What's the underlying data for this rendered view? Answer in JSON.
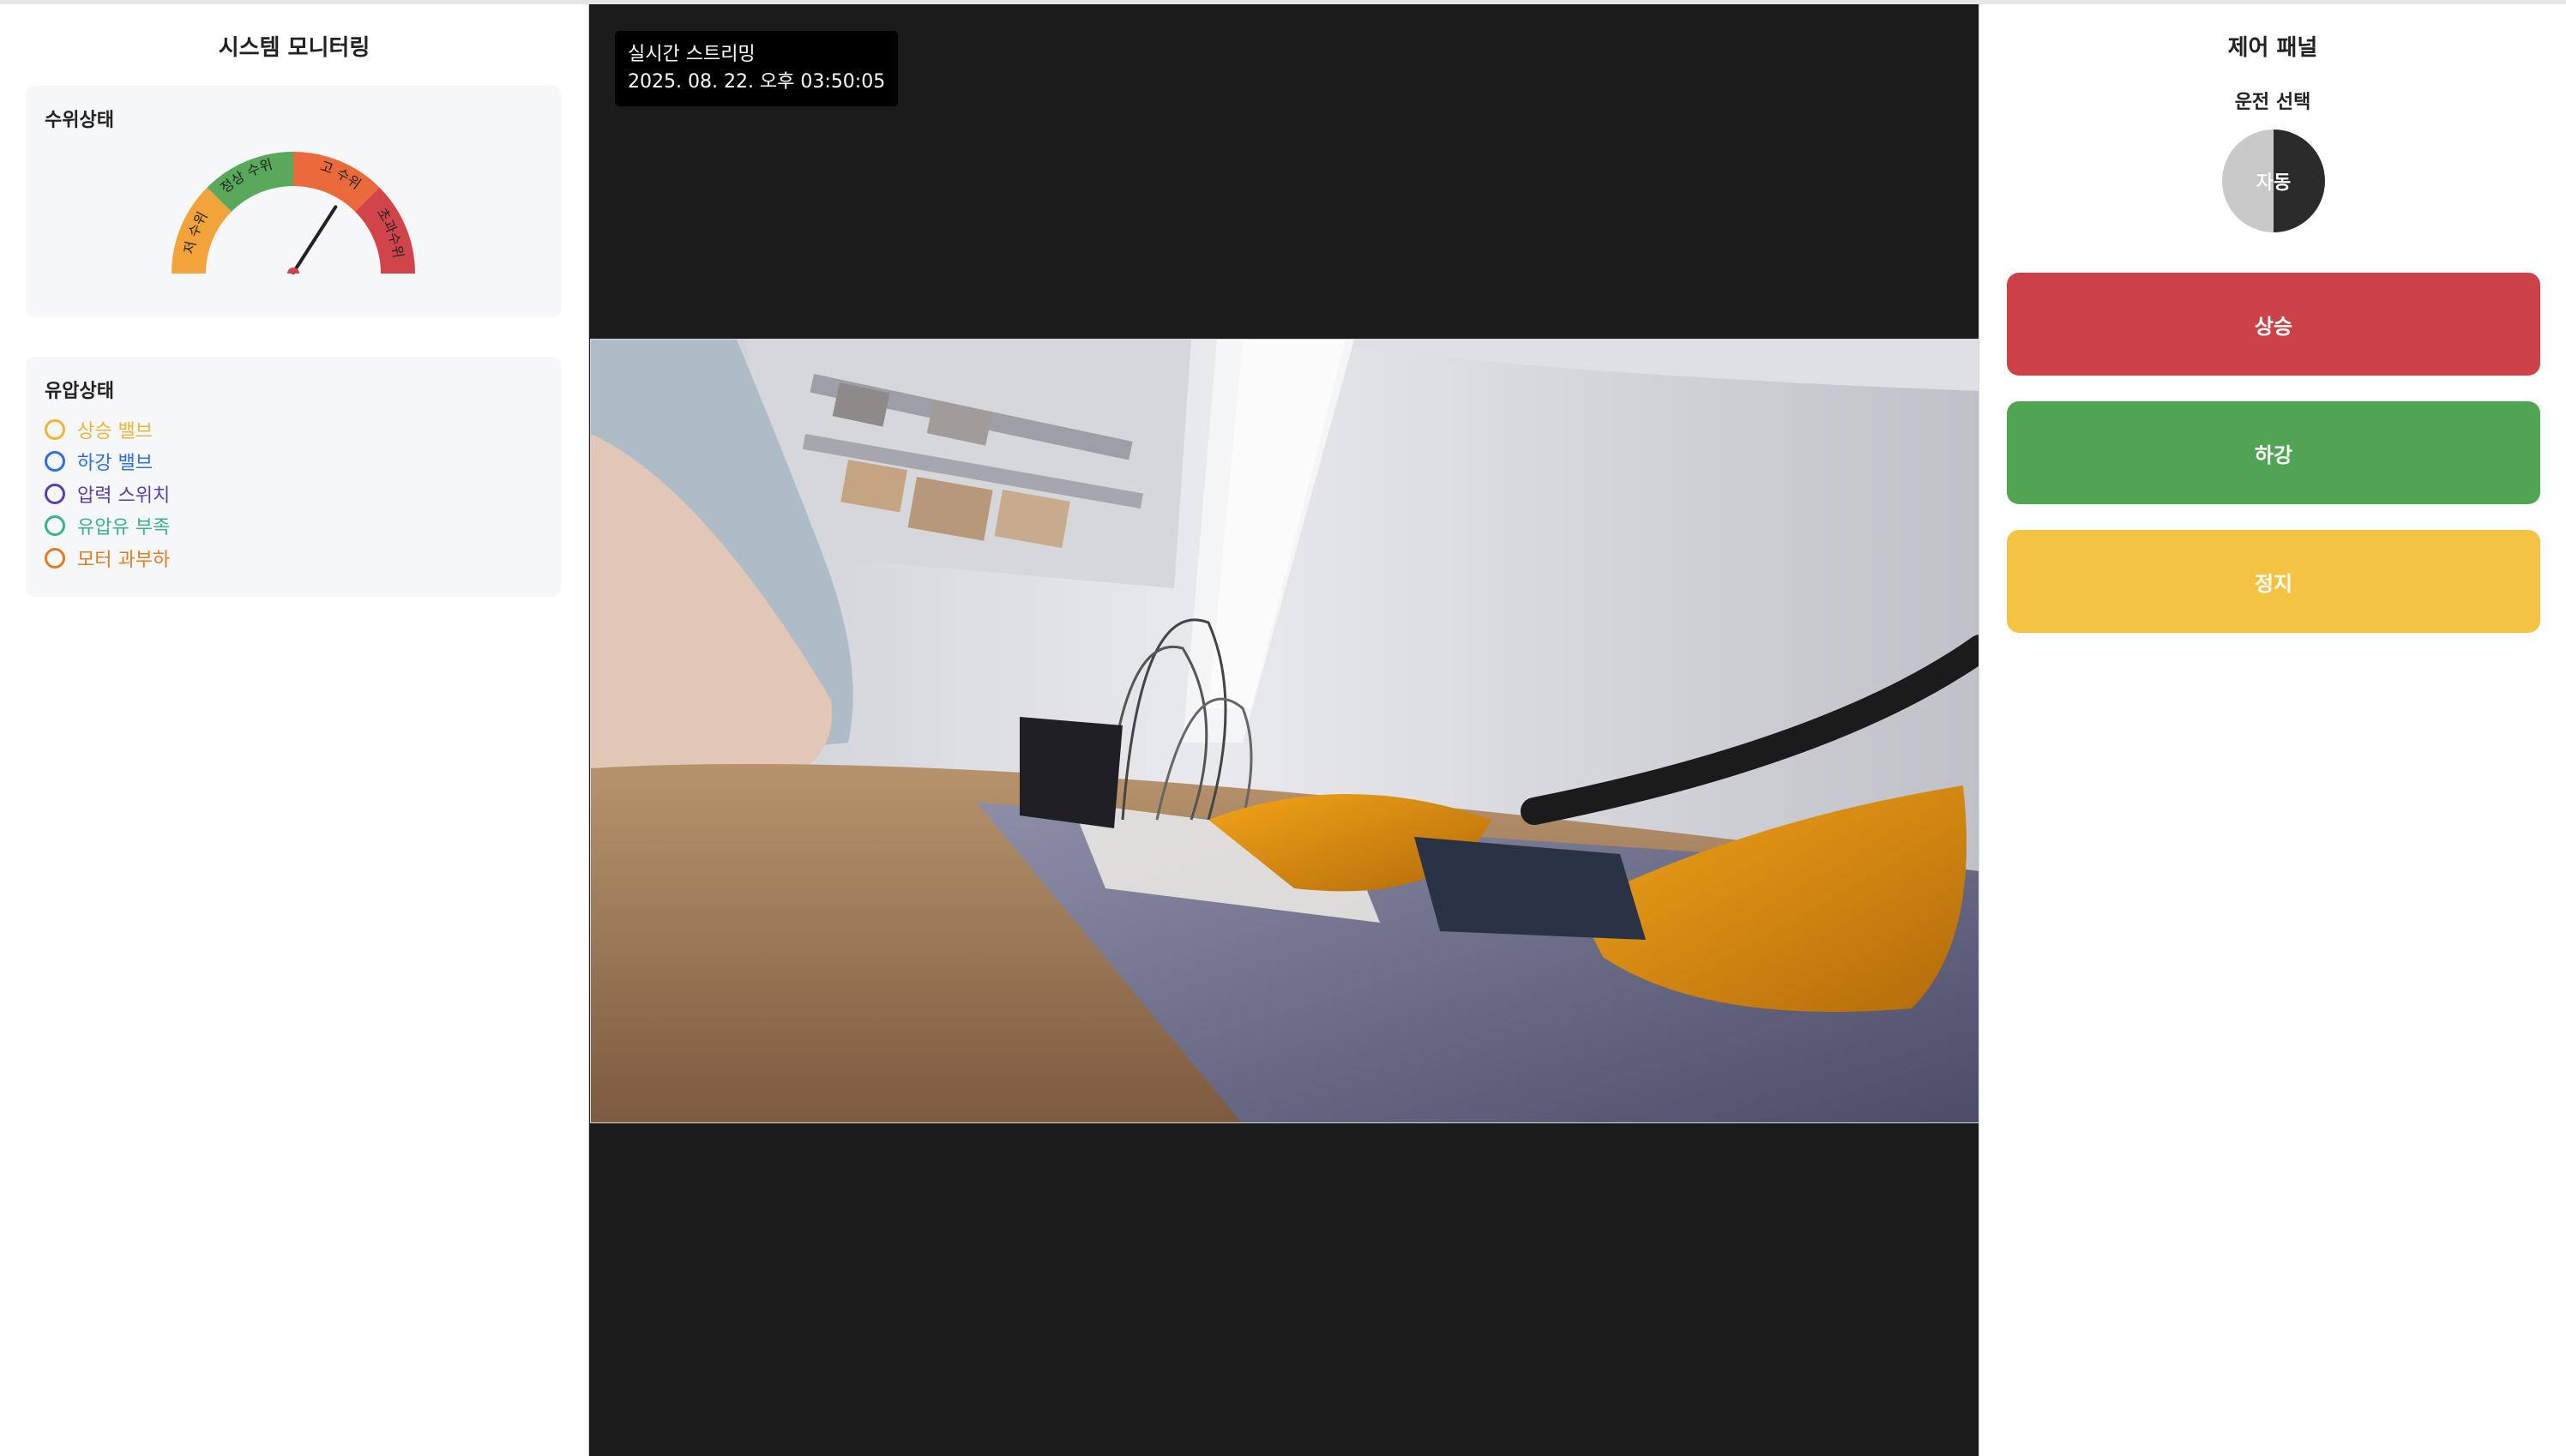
{
  "left_panel": {
    "title": "시스템 모니터링",
    "water": {
      "title": "수위상태",
      "zones": [
        "저 수위",
        "정상 수위",
        "고 수위",
        "초과수위"
      ],
      "zone_colors": [
        "#f2a33a",
        "#5aa85c",
        "#ea6a3c",
        "#d0444a"
      ],
      "level_fraction": 0.68
    },
    "oil": {
      "title": "유압상태",
      "items": [
        {
          "label": "상승 밸브",
          "color": "#f0b43a"
        },
        {
          "label": "하강 밸브",
          "color": "#2f6fe0"
        },
        {
          "label": "압력 스위치",
          "color": "#5b3fa6"
        },
        {
          "label": "유압유 부족",
          "color": "#3bb38a"
        },
        {
          "label": "모터 과부하",
          "color": "#e07c25"
        }
      ]
    }
  },
  "stream": {
    "label": "실시간 스트리밍",
    "timestamp": "2025. 08. 22. 오후 03:50:05"
  },
  "right_panel": {
    "title": "제어 패널",
    "mode_label": "운전 선택",
    "mode_value": "자동",
    "buttons": [
      {
        "label": "상승",
        "color": "#cc4248"
      },
      {
        "label": "하강",
        "color": "#51a453"
      },
      {
        "label": "정지",
        "color": "#f5c342"
      }
    ]
  }
}
